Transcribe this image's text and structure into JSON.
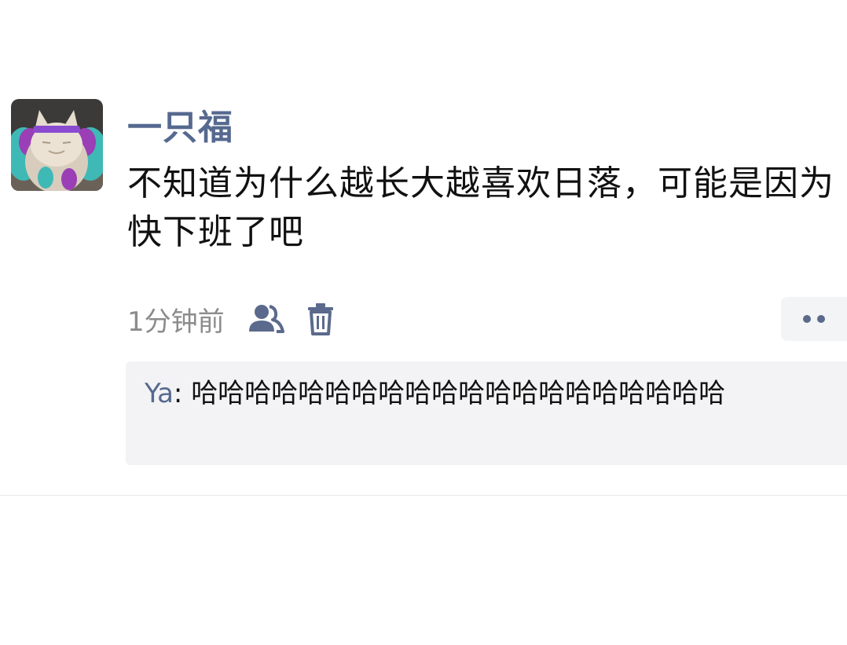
{
  "post": {
    "username": "一只福",
    "content": "不知道为什么越长大越喜欢日落，可能是因为快下班了吧",
    "timestamp": "1分钟前"
  },
  "icons": {
    "avatar": "fluffy-cat-avatar",
    "visibility": "friends-icon",
    "delete": "trash-icon",
    "more": "more-dots-icon"
  },
  "comments": [
    {
      "author": "Ya",
      "separator": ": ",
      "text": "哈哈哈哈哈哈哈哈哈哈哈哈哈哈哈哈哈哈哈哈"
    }
  ],
  "colors": {
    "name_link": "#56698f",
    "text": "#111111",
    "timestamp": "#8c8c8c",
    "comment_bg": "#f3f3f5"
  }
}
